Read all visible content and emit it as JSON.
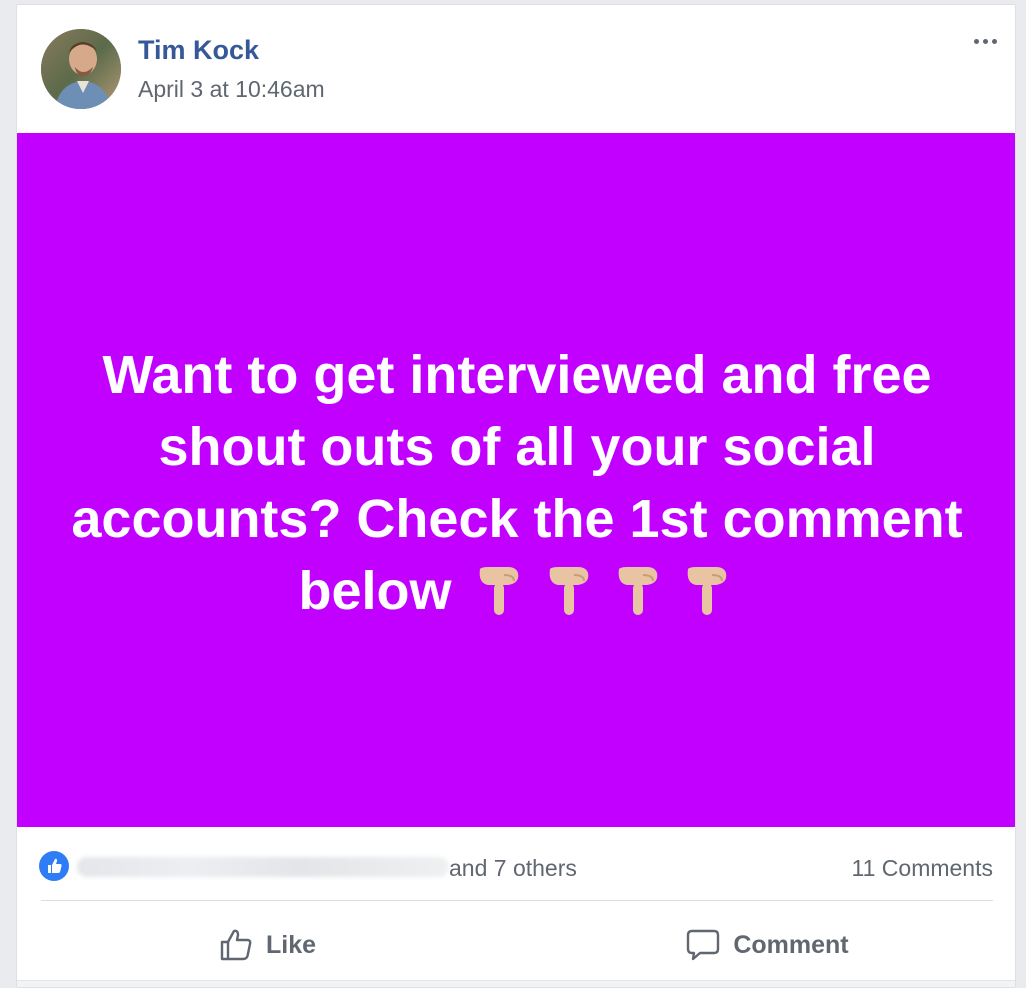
{
  "post": {
    "author": "Tim Kock",
    "timestamp": "April 3 at 10:46am",
    "banner_text": "Want to get interviewed and free shout outs of all your social accounts? Check the 1st comment below",
    "banner_color": "#c100ff",
    "banner_emoji": [
      "backhand-index-pointing-down",
      "backhand-index-pointing-down",
      "backhand-index-pointing-down",
      "backhand-index-pointing-down"
    ]
  },
  "reactions": {
    "others_text": "and 7 others",
    "comments_count": "11 Comments",
    "like_badge_color": "#2f7df6"
  },
  "actions": {
    "like_label": "Like",
    "comment_label": "Comment"
  },
  "colors": {
    "author_link": "#365899",
    "meta_text": "#606770"
  }
}
